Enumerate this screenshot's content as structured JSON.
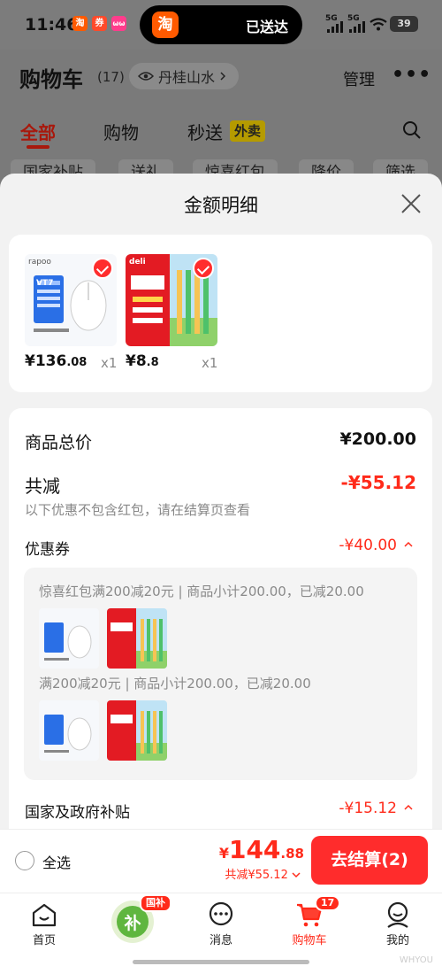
{
  "status_bar": {
    "time": "11:46",
    "apps": [
      "淘",
      "券",
      "ωω"
    ],
    "island_logo": "淘",
    "island_text": "已送达",
    "signal_1": "5G",
    "signal_2": "5G",
    "battery": "39"
  },
  "cart": {
    "title": "购物车",
    "count": "(17)",
    "location": "丹桂山水",
    "manage": "管理",
    "more": "•••",
    "tabs": [
      {
        "label": "全部",
        "active": true
      },
      {
        "label": "购物",
        "active": false
      },
      {
        "label": "秒送",
        "active": false
      }
    ],
    "tab_badge": "外卖",
    "filters": [
      "国家补贴",
      "送礼",
      "惊喜红包",
      "降价",
      "筛选"
    ]
  },
  "sheet": {
    "title": "金额明细",
    "products": [
      {
        "price_main": "¥136",
        "price_decimal": ".08",
        "qty": "x1",
        "brand": "rapoo",
        "model": "VT7",
        "accent": "#1b66e8"
      },
      {
        "price_main": "¥8",
        "price_decimal": ".8",
        "qty": "x1",
        "brand": "deli",
        "accent": "#e31b23"
      }
    ],
    "subtotal_label": "商品总价",
    "subtotal_value": "¥200.00",
    "discount_label": "共减",
    "discount_value": "-¥55.12",
    "discount_note": "以下优惠不包含红包，请在结算页查看",
    "coupon_label": "优惠券",
    "coupon_value": "-¥40.00",
    "coupon_lines": [
      "惊喜红包满200减20元 | 商品小计200.00，已减20.00",
      "满200减20元 | 商品小计200.00，已减20.00"
    ],
    "subsidy_label": "国家及政府补贴",
    "subsidy_value": "-¥15.12"
  },
  "checkout": {
    "select_all": "全选",
    "yen": "¥",
    "total_main": "144",
    "total_decimal": ".88",
    "saved": "共减¥55.12",
    "pay_button": "去结算(2)"
  },
  "nav": {
    "items": [
      {
        "label": "首页",
        "icon": "home-icon"
      },
      {
        "label": "",
        "icon": "subsidy-icon",
        "badge": "国补"
      },
      {
        "label": "消息",
        "icon": "message-icon"
      },
      {
        "label": "购物车",
        "icon": "cart-icon",
        "badge": "17",
        "active": true
      },
      {
        "label": "我的",
        "icon": "profile-icon"
      }
    ],
    "subsidy_glyph": "补"
  },
  "watermark": "WHYOU"
}
